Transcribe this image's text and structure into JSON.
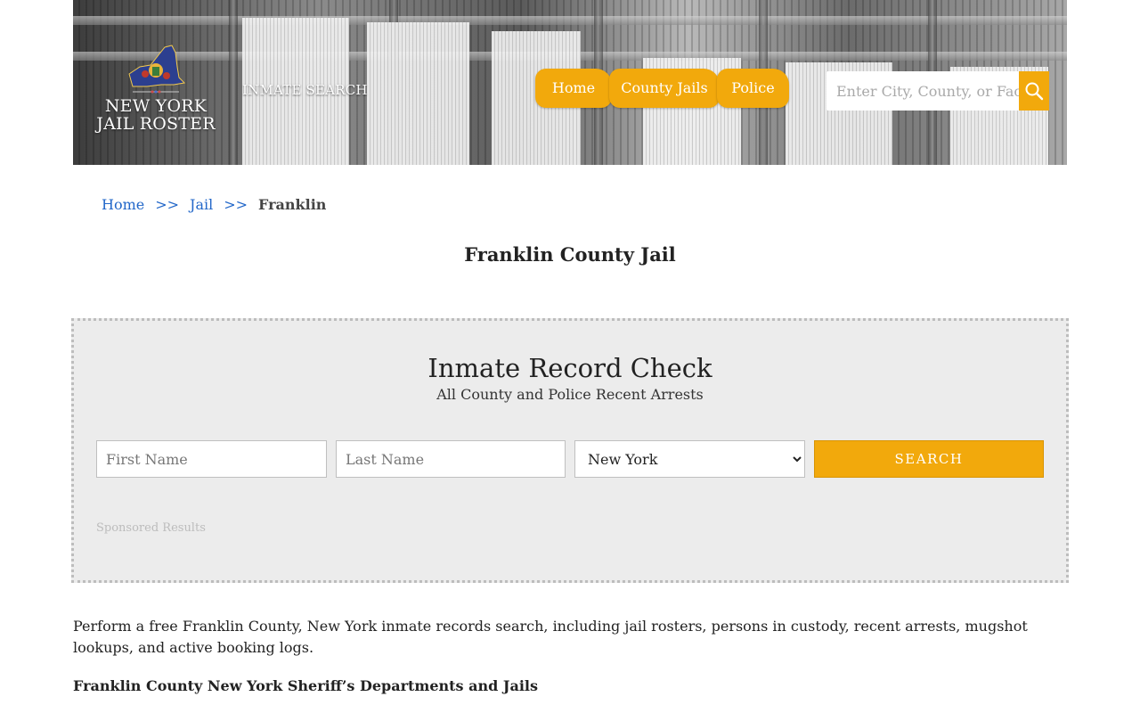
{
  "header": {
    "logo": {
      "line1": "NEW YORK",
      "line2": "JAIL ROSTER"
    },
    "inmate_search_link": "INMATE SEARCH",
    "nav": [
      {
        "label": "Home"
      },
      {
        "label": "County Jails"
      },
      {
        "label": "Police"
      }
    ],
    "site_search": {
      "placeholder": "Enter City, County, or Facility"
    },
    "accent_color": "#f2a90c"
  },
  "breadcrumb": {
    "home": "Home",
    "separator": ">>",
    "jail": "Jail",
    "current": "Franklin"
  },
  "page_title": "Franklin County Jail",
  "record_check": {
    "title": "Inmate Record Check",
    "subtitle": "All County and Police Recent Arrests",
    "first_name_placeholder": "First Name",
    "last_name_placeholder": "Last Name",
    "state_selected": "New York",
    "search_button": "SEARCH",
    "sponsored": "Sponsored Results"
  },
  "content": {
    "intro": "Perform a free Franklin County, New York inmate records search, including jail rosters, persons in custody, recent arrests, mugshot lookups, and active booking logs.",
    "section_heading": "Franklin County New York Sheriff’s Departments and Jails"
  }
}
